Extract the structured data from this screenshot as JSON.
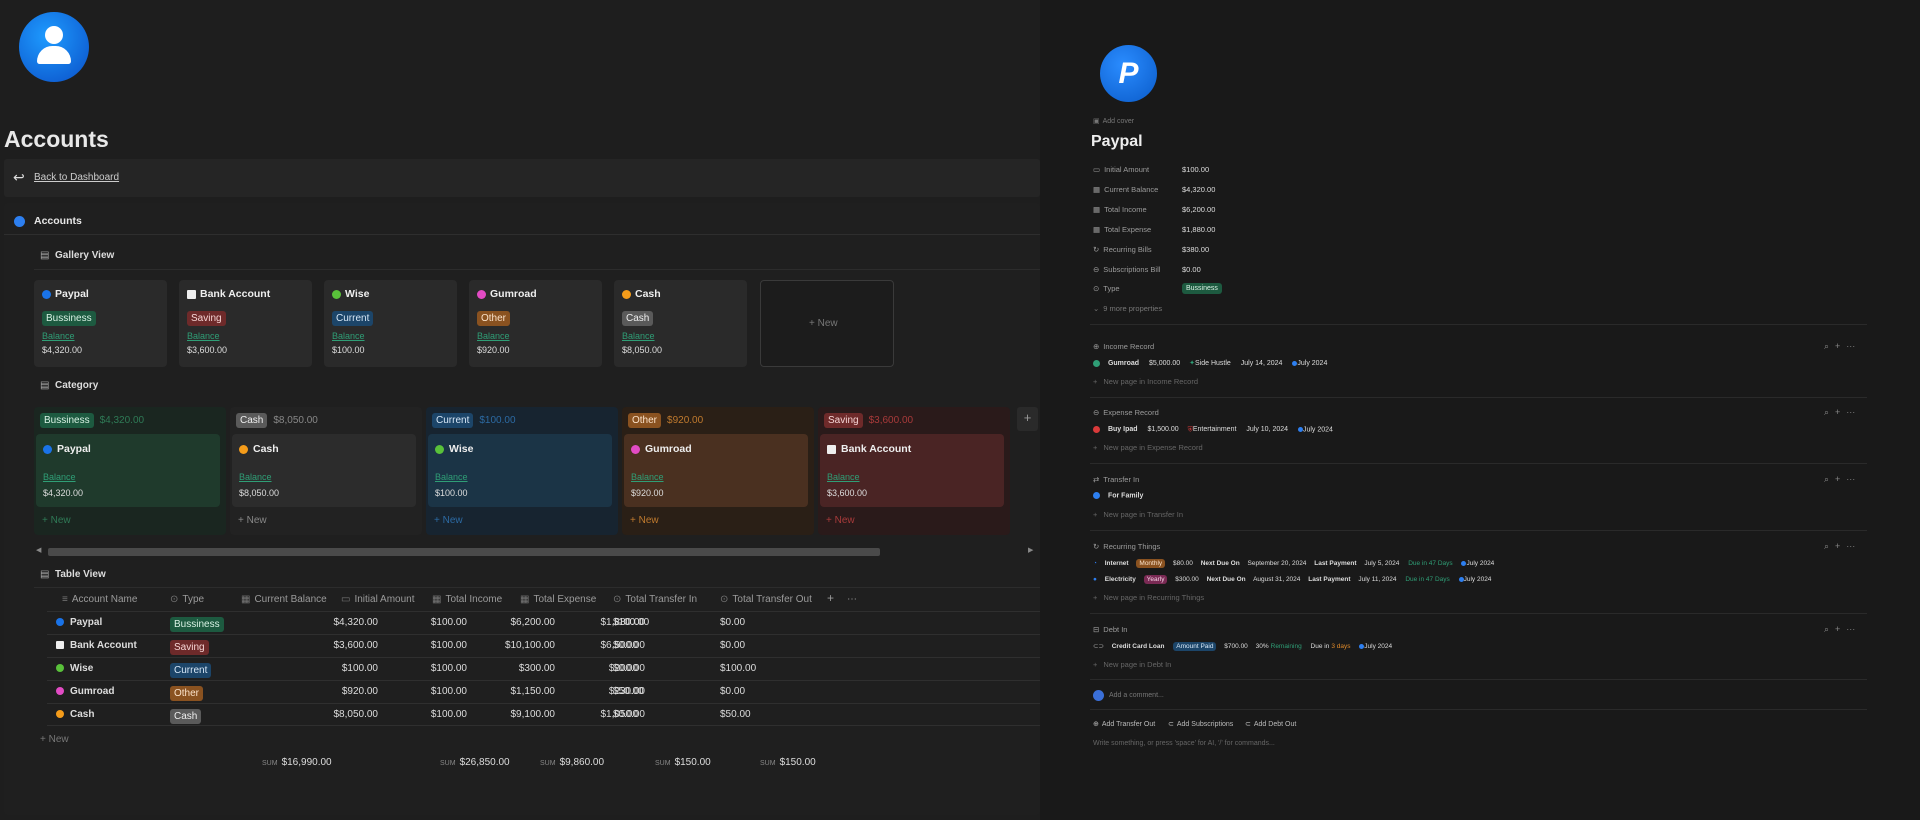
{
  "left": {
    "title": "Accounts",
    "back": "Back to Dashboard",
    "section_title": "Accounts",
    "gallery_title": "Gallery View",
    "gallery": [
      {
        "name": "Paypal",
        "tag": "Bussiness",
        "balance_label": "Balance",
        "value": "$4,320.00"
      },
      {
        "name": "Bank Account",
        "tag": "Saving",
        "balance_label": "Balance",
        "value": "$3,600.00"
      },
      {
        "name": "Wise",
        "tag": "Current",
        "balance_label": "Balance",
        "value": "$100.00"
      },
      {
        "name": "Gumroad",
        "tag": "Other",
        "balance_label": "Balance",
        "value": "$920.00"
      },
      {
        "name": "Cash",
        "tag": "Cash",
        "balance_label": "Balance",
        "value": "$8,050.00"
      }
    ],
    "gallery_new": "+ New",
    "category_title": "Category",
    "categories": [
      {
        "tag": "Bussiness",
        "total": "$4,320.00",
        "name": "Paypal",
        "balance_label": "Balance",
        "value": "$4,320.00",
        "new": "+ New"
      },
      {
        "tag": "Cash",
        "total": "$8,050.00",
        "name": "Cash",
        "balance_label": "Balance",
        "value": "$8,050.00",
        "new": "+ New"
      },
      {
        "tag": "Current",
        "total": "$100.00",
        "name": "Wise",
        "balance_label": "Balance",
        "value": "$100.00",
        "new": "+ New"
      },
      {
        "tag": "Other",
        "total": "$920.00",
        "name": "Gumroad",
        "balance_label": "Balance",
        "value": "$920.00",
        "new": "+ New"
      },
      {
        "tag": "Saving",
        "total": "$3,600.00",
        "name": "Bank Account",
        "balance_label": "Balance",
        "value": "$3,600.00",
        "new": "+ New"
      }
    ],
    "table_title": "Table View",
    "columns": [
      "Account Name",
      "Type",
      "Current Balance",
      "Initial Amount",
      "Total Income",
      "Total Expense",
      "Total Transfer In",
      "Total Transfer Out"
    ],
    "rows": [
      {
        "name": "Paypal",
        "type": "Bussiness",
        "cur": "$4,320.00",
        "init": "$100.00",
        "inc": "$6,200.00",
        "exp": "$1,880.00",
        "tin": "$100.00",
        "tout": "$0.00"
      },
      {
        "name": "Bank Account",
        "type": "Saving",
        "cur": "$3,600.00",
        "init": "$100.00",
        "inc": "$10,100.00",
        "exp": "$6,500.00",
        "tin": "$0.00",
        "tout": "$0.00"
      },
      {
        "name": "Wise",
        "type": "Current",
        "cur": "$100.00",
        "init": "$100.00",
        "inc": "$300.00",
        "exp": "$200.00",
        "tin": "$0.00",
        "tout": "$100.00"
      },
      {
        "name": "Gumroad",
        "type": "Other",
        "cur": "$920.00",
        "init": "$100.00",
        "inc": "$1,150.00",
        "exp": "$230.00",
        "tin": "$50.00",
        "tout": "$0.00"
      },
      {
        "name": "Cash",
        "type": "Cash",
        "cur": "$8,050.00",
        "init": "$100.00",
        "inc": "$9,100.00",
        "exp": "$1,050.00",
        "tin": "$0.00",
        "tout": "$50.00"
      }
    ],
    "table_new": "+ New",
    "sum_label": "SUM",
    "sums": {
      "cur": "$16,990.00",
      "inc": "$26,850.00",
      "exp": "$9,860.00",
      "tin": "$150.00",
      "tout": "$150.00"
    }
  },
  "right": {
    "add_cover": "Add cover",
    "title": "Paypal",
    "props": [
      {
        "label": "Initial Amount",
        "value": "$100.00"
      },
      {
        "label": "Current Balance",
        "value": "$4,320.00"
      },
      {
        "label": "Total Income",
        "value": "$6,200.00"
      },
      {
        "label": "Total Expense",
        "value": "$1,880.00"
      },
      {
        "label": "Recurring Bills",
        "value": "$380.00"
      },
      {
        "label": "Subscriptions Bill",
        "value": "$0.00"
      },
      {
        "label": "Type",
        "value": "Bussiness"
      }
    ],
    "more_props": "9 more properties",
    "income": {
      "title": "Income Record",
      "name": "Gumroad",
      "amount": "$5,000.00",
      "cat": "Side Hustle",
      "date": "July 14, 2024",
      "month": "July 2024",
      "new": "New page in Income Record"
    },
    "expense": {
      "title": "Expense Record",
      "name": "Buy Ipad",
      "amount": "$1,500.00",
      "cat": "Entertainment",
      "date": "July 10, 2024",
      "month": "July 2024",
      "new": "New page in Expense Record"
    },
    "transfer": {
      "title": "Transfer In",
      "name": "For Family",
      "new": "New page in Transfer In"
    },
    "recurring": {
      "title": "Recurring Things",
      "new": "New page in Recurring Things",
      "items": [
        {
          "name": "Internet",
          "freq": "Monthly",
          "amount": "$80.00",
          "next_label": "Next Due On",
          "next": "September 20, 2024",
          "last_label": "Last Payment",
          "last": "July 5, 2024",
          "due": "Due in 47 Days",
          "month": "July 2024"
        },
        {
          "name": "Electricity",
          "freq": "Yearly",
          "amount": "$300.00",
          "next_label": "Next Due On",
          "next": "August 31, 2024",
          "last_label": "Last Payment",
          "last": "July 11, 2024",
          "due": "Due in 47 Days",
          "month": "July 2024"
        }
      ]
    },
    "debt": {
      "title": "Debt In",
      "name": "Credit Card Loan",
      "paid_tag": "Amount Paid",
      "amount": "$700.00",
      "pct": "30%",
      "remaining": "Remaining",
      "due_pre": "Due in",
      "due_days": "3 days",
      "month": "July 2024",
      "new": "New page in Debt In"
    },
    "comment": "Add a comment...",
    "actions": [
      "Add Transfer Out",
      "Add Subscriptions",
      "Add Debt Out"
    ],
    "write": "Write something, or press 'space' for AI, '/' for commands..."
  }
}
